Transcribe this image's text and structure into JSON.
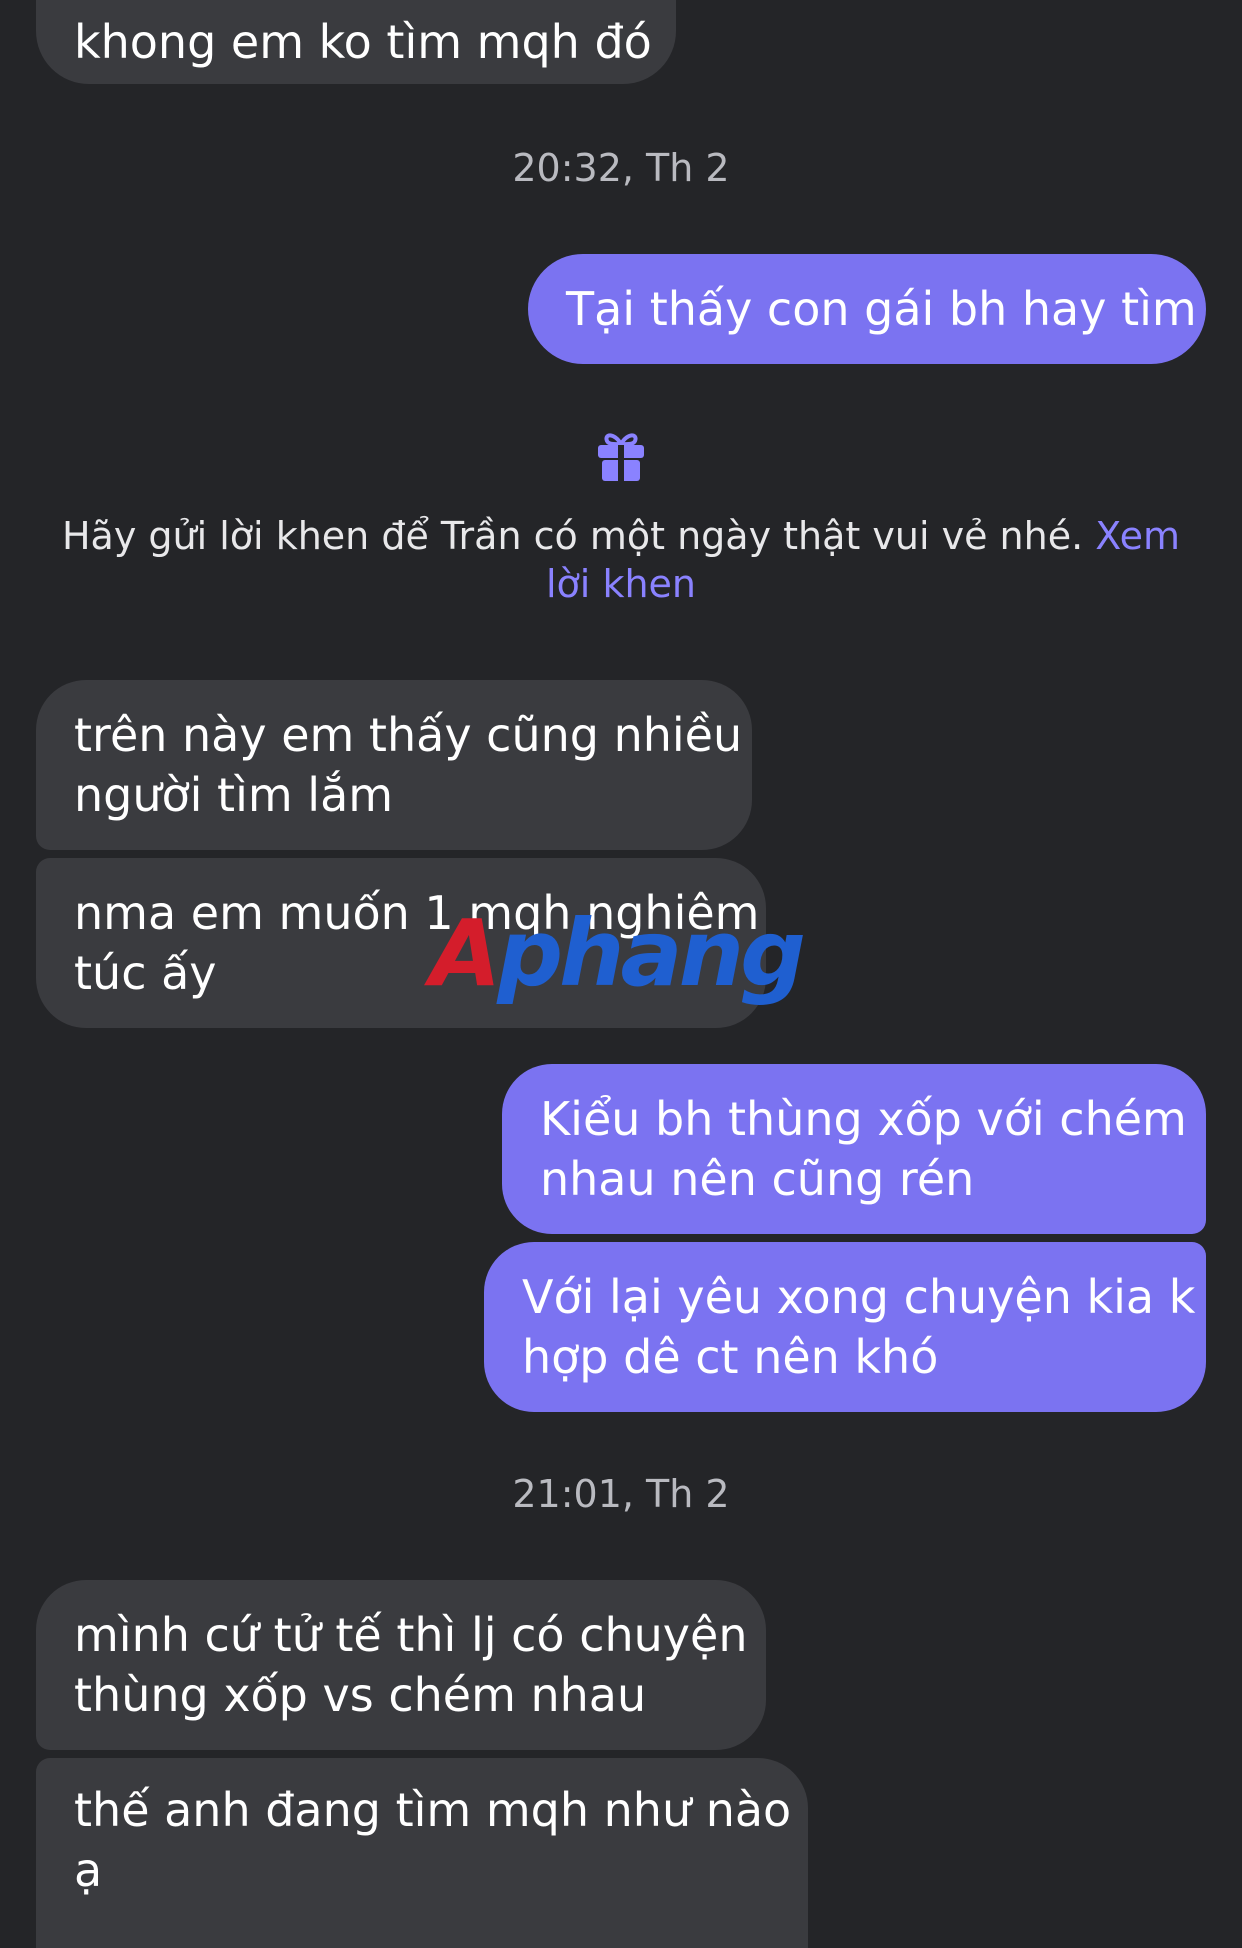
{
  "messages": [
    {
      "lines": [
        "khong em ko tìm mqh đó"
      ]
    },
    {
      "lines": [
        "Tại thấy con gái bh hay tìm"
      ]
    },
    {
      "lines": [
        "trên này em thấy cũng nhiều",
        "người tìm lắm"
      ]
    },
    {
      "lines": [
        "nma em muốn 1 mqh nghiêm",
        "túc ấy"
      ]
    },
    {
      "lines": [
        "Kiểu bh thùng xốp với chém",
        "nhau nên cũng rén"
      ]
    },
    {
      "lines": [
        "Với lại yêu xong chuyện kia k",
        "hợp dê ct nên khó"
      ]
    },
    {
      "lines": [
        "mình cứ tử tế thì lj có chuyện",
        "thùng xốp vs chém nhau"
      ]
    },
    {
      "lines": [
        "thế anh đang tìm mqh như nào",
        "ạ"
      ]
    }
  ],
  "timestamps": [
    "20:32, Th 2",
    "21:01, Th 2"
  ],
  "compliment": {
    "icon": "gift-icon",
    "text": "Hãy gửi lời khen để Trần có một ngày thật vui vẻ nhé.",
    "link_part1": "Xem",
    "link_part2": "lời khen"
  },
  "watermark": {
    "part1": "A",
    "part2": "phang"
  },
  "colors": {
    "background": "#242528",
    "incoming_bubble": "#3a3b3f",
    "outgoing_bubble": "#7b73f1",
    "link": "#8a82ff"
  }
}
